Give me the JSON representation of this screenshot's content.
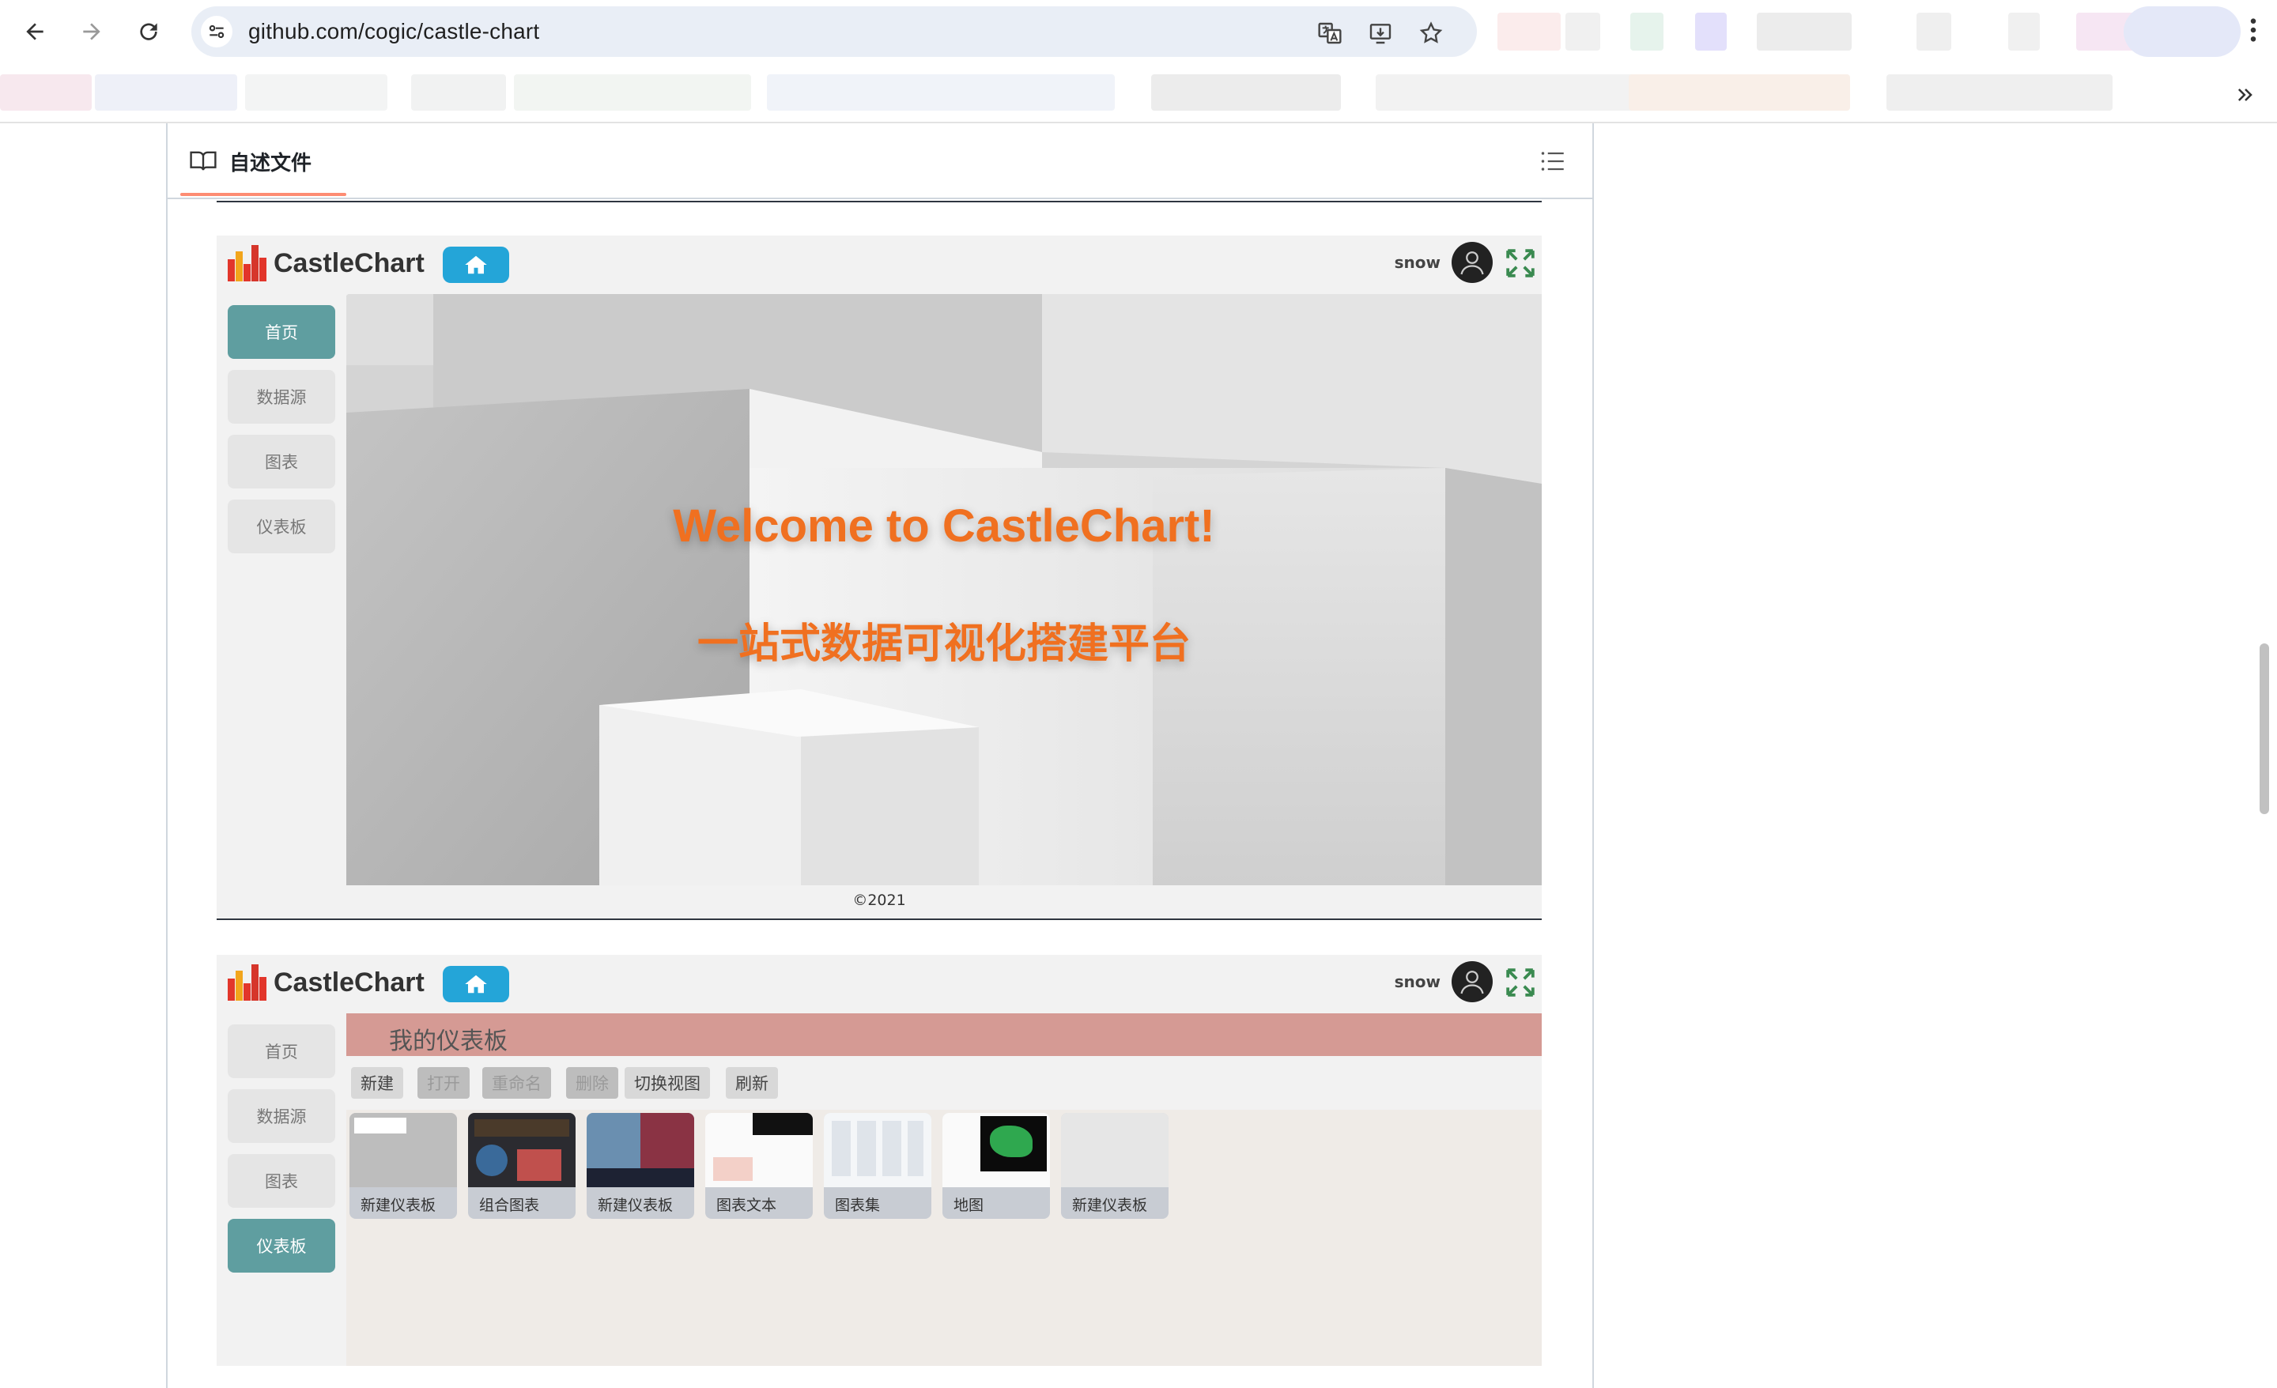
{
  "browser": {
    "url": "github.com/cogic/castle-chart",
    "icons": [
      "back-icon",
      "forward-icon",
      "reload-icon",
      "site-info-icon",
      "translate-icon",
      "install-icon",
      "bookmark-star-icon",
      "menu-icon",
      "chevrons-right-icon"
    ]
  },
  "readme": {
    "tab_label": "自述文件"
  },
  "app1": {
    "logo_text": "CastleChart",
    "user": "snow",
    "sidebar": [
      "首页",
      "数据源",
      "图表",
      "仪表板"
    ],
    "active_index": 0,
    "hero_title": "Welcome to CastleChart!",
    "hero_subtitle": "一站式数据可视化搭建平台",
    "footer": "©2021"
  },
  "app2": {
    "logo_text": "CastleChart",
    "user": "snow",
    "sidebar": [
      "首页",
      "数据源",
      "图表",
      "仪表板"
    ],
    "active_index": 3,
    "page_title": "我的仪表板",
    "toolbar": [
      {
        "label": "新建",
        "enabled": true
      },
      {
        "label": "打开",
        "enabled": false
      },
      {
        "label": "重命名",
        "enabled": false
      },
      {
        "label": "删除",
        "enabled": false
      },
      {
        "label": "切换视图",
        "enabled": true
      },
      {
        "label": "刷新",
        "enabled": true
      }
    ],
    "cards": [
      "新建仪表板",
      "组合图表",
      "新建仪表板",
      "图表文本",
      "图表集",
      "地图",
      "新建仪表板"
    ]
  },
  "colors": {
    "accent_teal": "#5f9ea0",
    "home_blue": "#24a5d8",
    "hero_orange": "#f07020",
    "dash_bar": "#d59a94"
  }
}
